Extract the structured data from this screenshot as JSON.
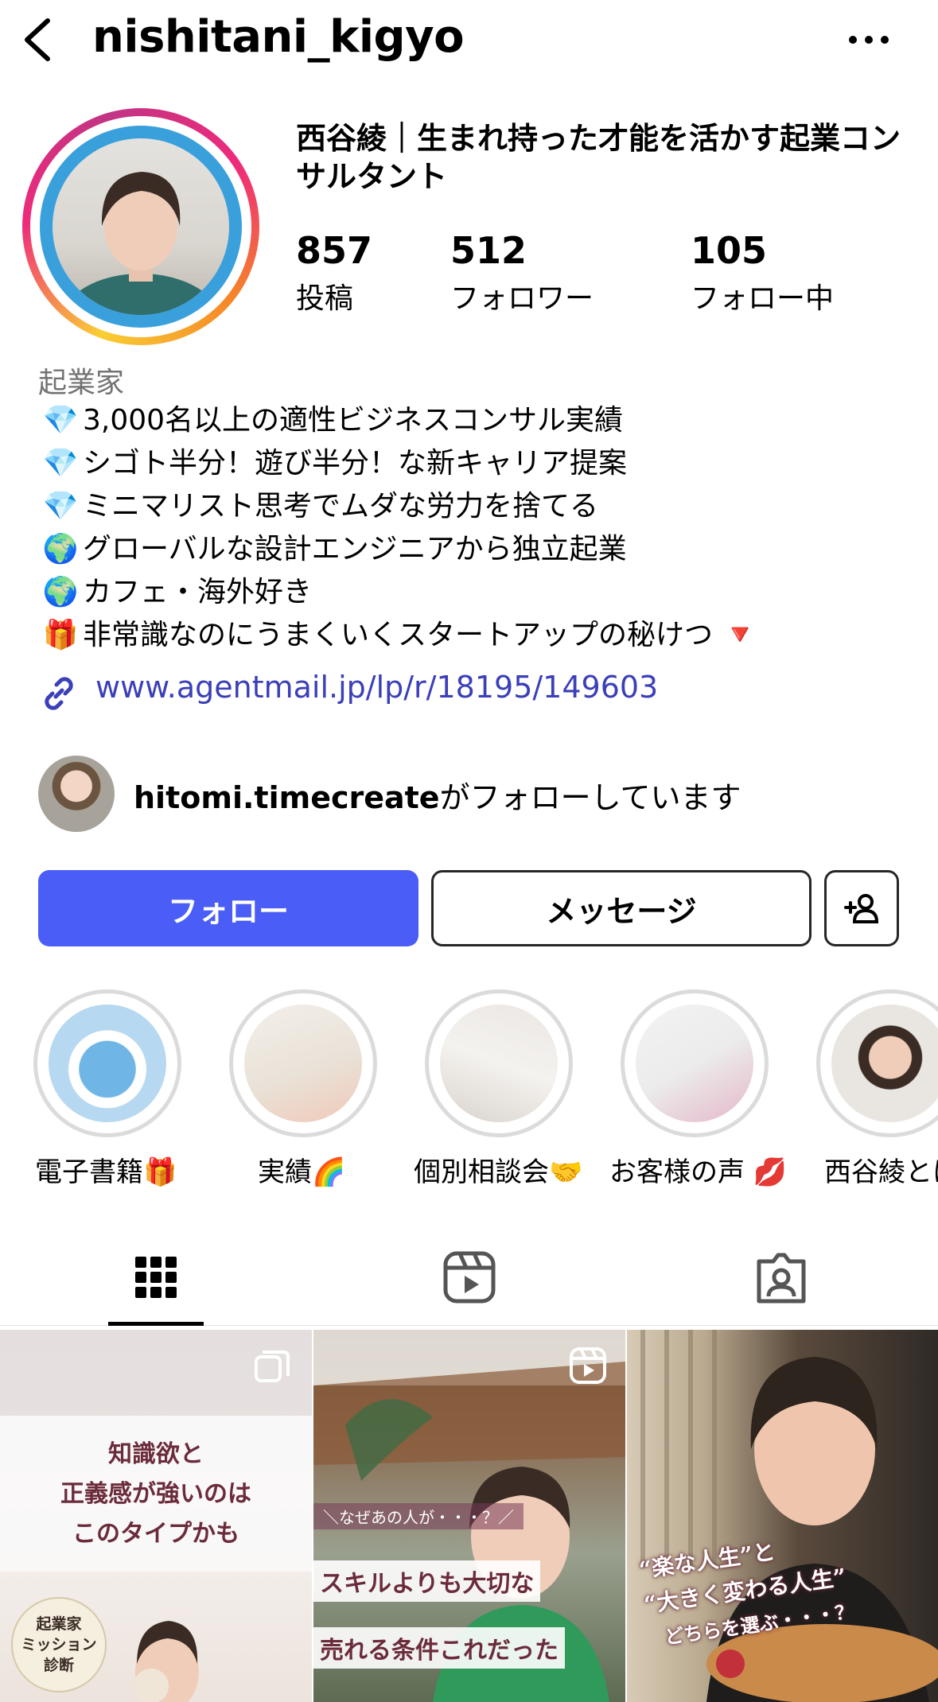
{
  "header": {
    "username": "nishitani_kigyo"
  },
  "profile": {
    "display_name": "西谷綾｜生まれ持った才能を活かす起業コンサルタント",
    "stats": [
      {
        "value": "857",
        "label": "投稿"
      },
      {
        "value": "512",
        "label": "フォロワー"
      },
      {
        "value": "105",
        "label": "フォロー中"
      }
    ],
    "category": "起業家",
    "bio": [
      {
        "emoji": "💎",
        "text": "3,000名以上の適性ビジネスコンサル実績"
      },
      {
        "emoji": "💎",
        "text": "シゴト半分！遊び半分！な新キャリア提案"
      },
      {
        "emoji": "💎",
        "text": "ミニマリスト思考でムダな労力を捨てる"
      },
      {
        "emoji": "🌍",
        "text": "グローバルな設計エンジニアから独立起業"
      },
      {
        "emoji": "🌍",
        "text": "カフェ・海外好き"
      },
      {
        "emoji": "🎁",
        "text": "非常識なのにうまくいくスタートアップの秘けつ 🔻"
      }
    ],
    "link": "www.agentmail.jp/lp/r/18195/149603",
    "mutual": {
      "username": "hitomi.timecreate",
      "suffix": "がフォローしています"
    }
  },
  "buttons": {
    "follow": "フォロー",
    "message": "メッセージ"
  },
  "highlights": [
    {
      "label": "電子書籍🎁"
    },
    {
      "label": "実績🌈"
    },
    {
      "label": "個別相談会🤝"
    },
    {
      "label": "お客様の声 💋"
    },
    {
      "label": "西谷綾とは"
    }
  ],
  "posts": [
    {
      "lines": [
        "知識欲と",
        "正義感が強いのは",
        "このタイプかも"
      ],
      "badge": [
        "起業家",
        "ミッション",
        "診断"
      ]
    },
    {
      "tag": "＼なぜあの人が・・・？／",
      "lines": [
        "スキルよりも大切な",
        "売れる条件これだった"
      ]
    },
    {
      "lines": [
        "“楽な人生”と",
        "“大きく変わる人生”",
        "どちらを選ぶ・・・？"
      ]
    }
  ]
}
